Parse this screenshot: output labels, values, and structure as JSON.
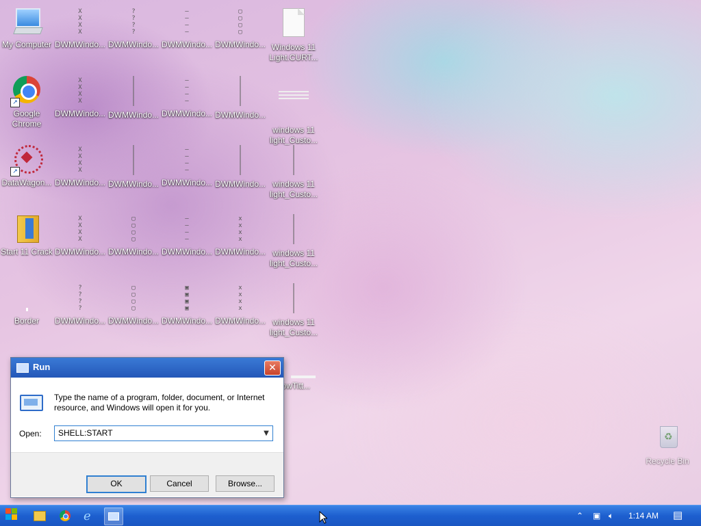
{
  "desktop": {
    "icons": [
      {
        "label": "My Computer",
        "label2": ""
      },
      {
        "label": "DWMWindo...",
        "label2": ""
      },
      {
        "label": "DWMWindo...",
        "label2": ""
      },
      {
        "label": "DWMWindo...",
        "label2": ""
      },
      {
        "label": "DWMWindo...",
        "label2": ""
      },
      {
        "label": "Windows 11",
        "label2": "Light.CURT..."
      },
      {
        "label": "Google",
        "label2": "Chrome"
      },
      {
        "label": "DWMWindo...",
        "label2": ""
      },
      {
        "label": "DWMWindo...",
        "label2": ""
      },
      {
        "label": "DWMWindo...",
        "label2": ""
      },
      {
        "label": "DWMWindo...",
        "label2": ""
      },
      {
        "label": "windows 11",
        "label2": "light_Custo..."
      },
      {
        "label": "DataWagon...",
        "label2": ""
      },
      {
        "label": "DWMWindo...",
        "label2": ""
      },
      {
        "label": "DWMWindo...",
        "label2": ""
      },
      {
        "label": "DWMWindo...",
        "label2": ""
      },
      {
        "label": "DWMWindo...",
        "label2": ""
      },
      {
        "label": "windows 11",
        "label2": "light_Custo..."
      },
      {
        "label": "Start 11 Crack",
        "label2": ""
      },
      {
        "label": "DWMWindo...",
        "label2": ""
      },
      {
        "label": "DWMWindo...",
        "label2": ""
      },
      {
        "label": "DWMWindo...",
        "label2": ""
      },
      {
        "label": "DWMWindo...",
        "label2": ""
      },
      {
        "label": "windows 11",
        "label2": "light_Custo..."
      },
      {
        "label": "Border",
        "label2": ""
      },
      {
        "label": "DWMWindo...",
        "label2": ""
      },
      {
        "label": "DWMWindo...",
        "label2": ""
      },
      {
        "label": "DWMWindo...",
        "label2": ""
      },
      {
        "label": "DWMWindo...",
        "label2": ""
      },
      {
        "label": "windows 11",
        "label2": "light_Custo..."
      },
      {
        "label": "dowTitt...",
        "label2": ""
      },
      {
        "label": "Recycle Bin",
        "label2": ""
      }
    ]
  },
  "run_dialog": {
    "title": "Run",
    "close": "✕",
    "description": "Type the name of a program, folder, document, or Internet resource, and Windows will open it for you.",
    "open_label": "Open:",
    "open_value": "SHELL:START",
    "buttons": {
      "ok": "OK",
      "cancel": "Cancel",
      "browse": "Browse..."
    }
  },
  "taskbar": {
    "clock": "1:14 AM"
  }
}
